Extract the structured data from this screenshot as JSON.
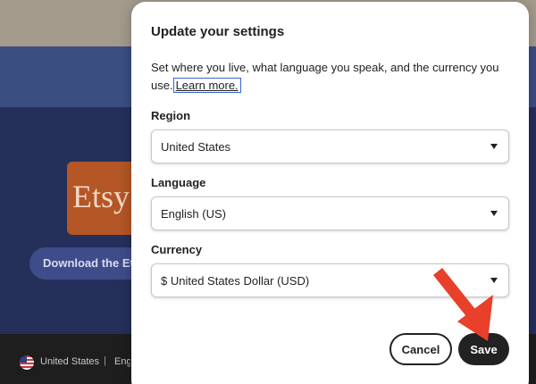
{
  "background": {
    "logo_text": "Etsy",
    "download_label": "Download the Etsy App",
    "footer": {
      "region": "United States",
      "separator": "|",
      "language": "English"
    }
  },
  "modal": {
    "title": "Update your settings",
    "description": "Set where you live, what language you speak, and the currency you use.",
    "learn_more": "Learn more.",
    "region": {
      "label": "Region",
      "value": "United States"
    },
    "language": {
      "label": "Language",
      "value": "English (US)"
    },
    "currency": {
      "label": "Currency",
      "value": "$ United States Dollar (USD)"
    },
    "cancel_label": "Cancel",
    "save_label": "Save"
  },
  "annotation": {
    "arrow_color": "#e8402a"
  },
  "icons": {
    "select_caret": "caret-down-icon",
    "footer_flag": "us-flag-icon"
  }
}
